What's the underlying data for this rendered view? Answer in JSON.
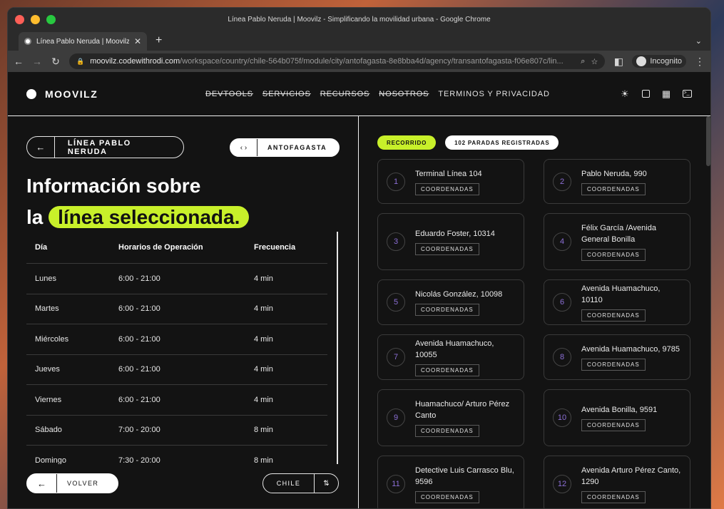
{
  "browser": {
    "window_title": "Línea Pablo Neruda | Moovilz - Simplificando la movilidad urbana - Google Chrome",
    "tab_title": "Línea Pablo Neruda | Moovilz",
    "url_host": "moovilz.codewithrodi.com",
    "url_path": "/workspace/country/chile-564b075f/module/city/antofagasta-8e8bba4d/agency/transantofagasta-f06e807c/lin...",
    "incognito_label": "Incognito"
  },
  "header": {
    "logo": "MOOVILZ",
    "nav": [
      "DEVTOOLS",
      "SERVICIOS",
      "RECURSOS",
      "NOSOTROS",
      "TERMINOS Y PRIVACIDAD"
    ]
  },
  "left": {
    "line_label": "LÍNEA PABLO NERUDA",
    "city_label": "ANTOFAGASTA",
    "headline_line1": "Información sobre",
    "headline_la": "la",
    "headline_highlight": "línea seleccionada.",
    "table": {
      "headers": [
        "Día",
        "Horarios de Operación",
        "Frecuencia"
      ],
      "rows": [
        [
          "Lunes",
          "6:00 - 21:00",
          "4 min"
        ],
        [
          "Martes",
          "6:00 - 21:00",
          "4 min"
        ],
        [
          "Miércoles",
          "6:00 - 21:00",
          "4 min"
        ],
        [
          "Jueves",
          "6:00 - 21:00",
          "4 min"
        ],
        [
          "Viernes",
          "6:00 - 21:00",
          "4 min"
        ],
        [
          "Sábado",
          "7:00 - 20:00",
          "8 min"
        ],
        [
          "Domingo",
          "7:30 - 20:00",
          "8 min"
        ]
      ]
    },
    "back_label": "VOLVER",
    "country_label": "CHILE"
  },
  "right": {
    "badge_route": "RECORRIDO",
    "badge_count": "102 PARADAS REGISTRADAS",
    "coord_label": "COORDENADAS",
    "stops": [
      {
        "num": "1",
        "name": "Terminal Línea 104"
      },
      {
        "num": "2",
        "name": "Pablo Neruda, 990"
      },
      {
        "num": "3",
        "name": "Eduardo Foster, 10314"
      },
      {
        "num": "4",
        "name": "Félix García /Avenida General Bonilla"
      },
      {
        "num": "5",
        "name": "Nicolás González, 10098"
      },
      {
        "num": "6",
        "name": "Avenida Huamachuco, 10110"
      },
      {
        "num": "7",
        "name": "Avenida Huamachuco, 10055"
      },
      {
        "num": "8",
        "name": "Avenida Huamachuco, 9785"
      },
      {
        "num": "9",
        "name": "Huamachuco/ Arturo Pérez Canto"
      },
      {
        "num": "10",
        "name": "Avenida Bonilla, 9591"
      },
      {
        "num": "11",
        "name": "Detective Luis Carrasco Blu, 9596"
      },
      {
        "num": "12",
        "name": "Avenida Arturo Pérez Canto, 1290"
      }
    ]
  }
}
